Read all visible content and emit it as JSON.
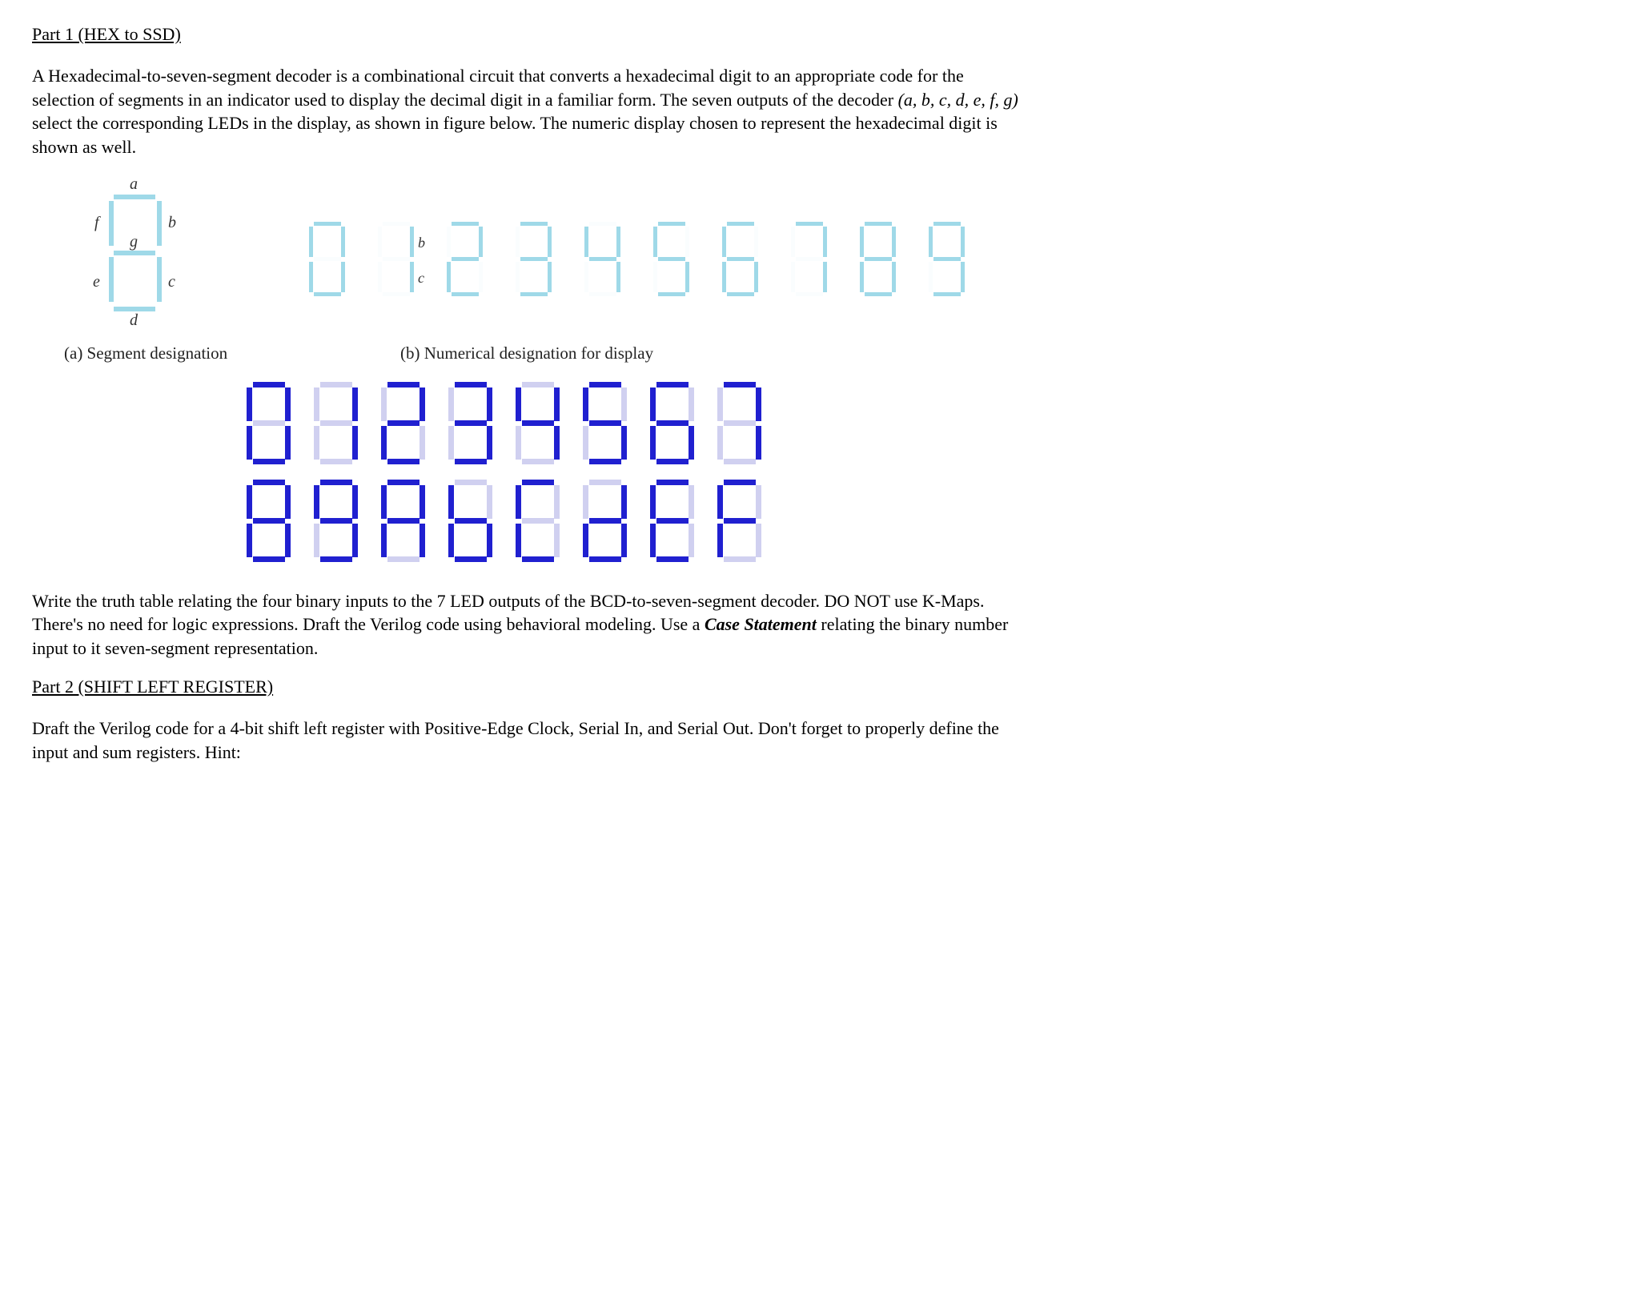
{
  "part1": {
    "heading": "Part 1 (HEX to SSD)",
    "intro_before_italic": "A Hexadecimal-to-seven-segment decoder is a combinational circuit that converts a hexadecimal digit to an appropriate code for the selection of segments in an indicator used to display the decimal digit in a familiar form. The seven outputs of the decoder ",
    "intro_italic": "(a, b, c, d, e, f, g)",
    "intro_after_italic": " select the corresponding LEDs in the display, as shown in figure below. The numeric display chosen to represent the hexadecimal digit is shown as well.",
    "seg_labels": {
      "a": "a",
      "b": "b",
      "c": "c",
      "d": "d",
      "e": "e",
      "f": "f",
      "g": "g"
    },
    "extra_labels": {
      "b": "b",
      "c": "c"
    },
    "caption_a": "(a) Segment designation",
    "caption_b": "(b) Numerical designation for display",
    "digits_0_9": [
      {
        "a": 1,
        "b": 1,
        "c": 1,
        "d": 1,
        "e": 1,
        "f": 1,
        "g": 0
      },
      {
        "a": 0,
        "b": 1,
        "c": 1,
        "d": 0,
        "e": 0,
        "f": 0,
        "g": 0
      },
      {
        "a": 1,
        "b": 1,
        "c": 0,
        "d": 1,
        "e": 1,
        "f": 0,
        "g": 1
      },
      {
        "a": 1,
        "b": 1,
        "c": 1,
        "d": 1,
        "e": 0,
        "f": 0,
        "g": 1
      },
      {
        "a": 0,
        "b": 1,
        "c": 1,
        "d": 0,
        "e": 0,
        "f": 1,
        "g": 1
      },
      {
        "a": 1,
        "b": 0,
        "c": 1,
        "d": 1,
        "e": 0,
        "f": 1,
        "g": 1
      },
      {
        "a": 1,
        "b": 0,
        "c": 1,
        "d": 1,
        "e": 1,
        "f": 1,
        "g": 1
      },
      {
        "a": 1,
        "b": 1,
        "c": 1,
        "d": 0,
        "e": 0,
        "f": 0,
        "g": 0
      },
      {
        "a": 1,
        "b": 1,
        "c": 1,
        "d": 1,
        "e": 1,
        "f": 1,
        "g": 1
      },
      {
        "a": 1,
        "b": 1,
        "c": 1,
        "d": 1,
        "e": 0,
        "f": 1,
        "g": 1
      }
    ],
    "hex_digits": [
      [
        {
          "a": 1,
          "b": 1,
          "c": 1,
          "d": 1,
          "e": 1,
          "f": 1,
          "g": 0
        },
        {
          "a": 0,
          "b": 1,
          "c": 1,
          "d": 0,
          "e": 0,
          "f": 0,
          "g": 0
        },
        {
          "a": 1,
          "b": 1,
          "c": 0,
          "d": 1,
          "e": 1,
          "f": 0,
          "g": 1
        },
        {
          "a": 1,
          "b": 1,
          "c": 1,
          "d": 1,
          "e": 0,
          "f": 0,
          "g": 1
        },
        {
          "a": 0,
          "b": 1,
          "c": 1,
          "d": 0,
          "e": 0,
          "f": 1,
          "g": 1
        },
        {
          "a": 1,
          "b": 0,
          "c": 1,
          "d": 1,
          "e": 0,
          "f": 1,
          "g": 1
        },
        {
          "a": 1,
          "b": 0,
          "c": 1,
          "d": 1,
          "e": 1,
          "f": 1,
          "g": 1
        },
        {
          "a": 1,
          "b": 1,
          "c": 1,
          "d": 0,
          "e": 0,
          "f": 0,
          "g": 0
        }
      ],
      [
        {
          "a": 1,
          "b": 1,
          "c": 1,
          "d": 1,
          "e": 1,
          "f": 1,
          "g": 1
        },
        {
          "a": 1,
          "b": 1,
          "c": 1,
          "d": 1,
          "e": 0,
          "f": 1,
          "g": 1
        },
        {
          "a": 1,
          "b": 1,
          "c": 1,
          "d": 0,
          "e": 1,
          "f": 1,
          "g": 1
        },
        {
          "a": 0,
          "b": 0,
          "c": 1,
          "d": 1,
          "e": 1,
          "f": 1,
          "g": 1
        },
        {
          "a": 1,
          "b": 0,
          "c": 0,
          "d": 1,
          "e": 1,
          "f": 1,
          "g": 0
        },
        {
          "a": 0,
          "b": 1,
          "c": 1,
          "d": 1,
          "e": 1,
          "f": 0,
          "g": 1
        },
        {
          "a": 1,
          "b": 0,
          "c": 0,
          "d": 1,
          "e": 1,
          "f": 1,
          "g": 1
        },
        {
          "a": 1,
          "b": 0,
          "c": 0,
          "d": 0,
          "e": 1,
          "f": 1,
          "g": 1
        }
      ]
    ],
    "task_before_bold": "Write the truth table relating the four binary inputs to the 7 LED outputs of the BCD-to-seven-segment decoder. DO NOT use K-Maps.  There's no need for logic expressions.  Draft the Verilog code using behavioral modeling.  Use a ",
    "task_bold": "Case Statement",
    "task_after_bold": " relating the binary number input to it seven-segment representation."
  },
  "part2": {
    "heading": "Part 2 (SHIFT LEFT REGISTER)",
    "body": "Draft the Verilog code for a 4-bit shift left register with Positive-Edge Clock, Serial In, and Serial Out. Don't forget to properly define the input and sum registers. Hint:"
  }
}
